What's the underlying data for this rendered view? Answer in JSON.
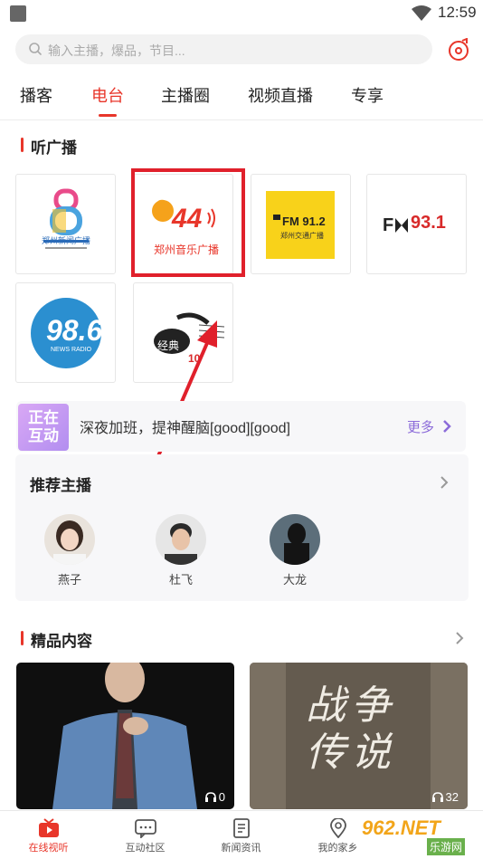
{
  "status_bar": {
    "time": "12:59"
  },
  "search": {
    "placeholder": "输入主播，爆品，节目..."
  },
  "tabs": [
    {
      "label": "播客",
      "active": false
    },
    {
      "label": "电台",
      "active": true
    },
    {
      "label": "主播圈",
      "active": false
    },
    {
      "label": "视频直播",
      "active": false
    },
    {
      "label": "专享",
      "active": false
    }
  ],
  "listen_section": {
    "title": "听广播"
  },
  "stations": [
    {
      "logo_text": "郑州新闻广播"
    },
    {
      "logo_text": "郑州音乐广播",
      "freq": "94.4"
    },
    {
      "logo_text": "郑州交通广播",
      "freq": "FM 91.2"
    },
    {
      "logo_text": "FM 93.1",
      "freq": "93.1"
    },
    {
      "logo_text": "NEWS RADIO",
      "freq": "98.6"
    },
    {
      "logo_text": "经典",
      "freq": "10"
    }
  ],
  "live_banner": {
    "badge_line1": "正在",
    "badge_line2": "互动",
    "text": "深夜加班，提神醒脑[good][good]",
    "more": "更多"
  },
  "hosts_section": {
    "title": "推荐主播",
    "hosts": [
      {
        "name": "燕子"
      },
      {
        "name": "杜飞"
      },
      {
        "name": "大龙"
      }
    ]
  },
  "premium_section": {
    "title": "精品内容",
    "items": [
      {
        "plays": "0"
      },
      {
        "plays": "32",
        "cover_text": "战争传说"
      }
    ]
  },
  "bottom_nav": [
    {
      "label": "在线视听",
      "icon": "tv-icon",
      "active": true
    },
    {
      "label": "互动社区",
      "icon": "chat-icon",
      "active": false
    },
    {
      "label": "新闻资讯",
      "icon": "news-icon",
      "active": false
    },
    {
      "label": "我的家乡",
      "icon": "location-icon",
      "active": false
    }
  ],
  "watermark": {
    "text": "962.NET",
    "subtext": "乐游网"
  },
  "colors": {
    "accent": "#e8362a",
    "purple": "#8b6bd9"
  }
}
